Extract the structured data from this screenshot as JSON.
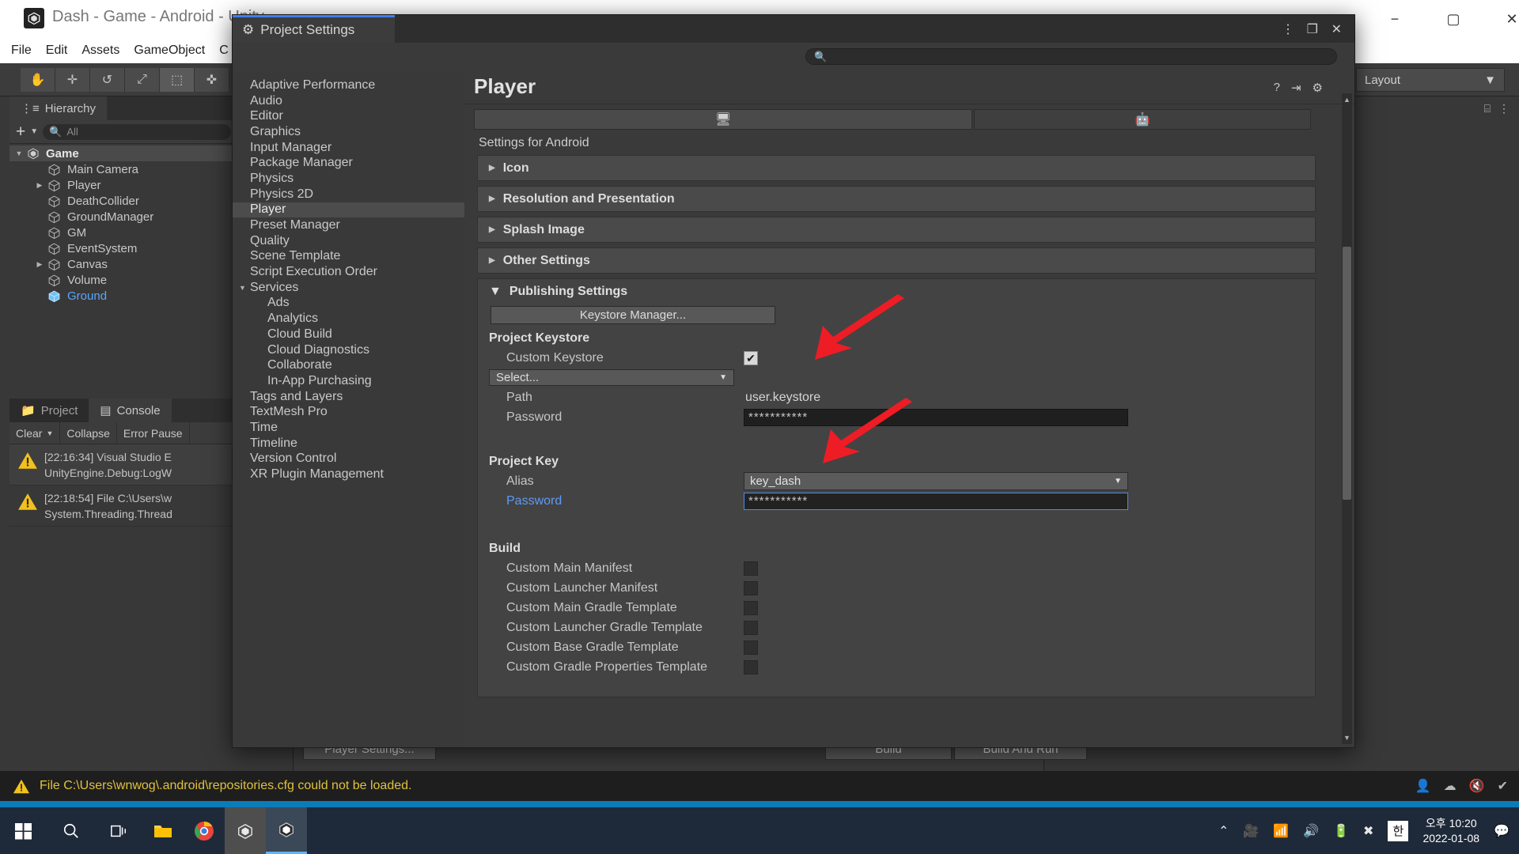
{
  "unity_window": {
    "title": "Dash - Game - Android - Unity",
    "app_icon": "unity-icon",
    "menus": [
      "File",
      "Edit",
      "Assets",
      "GameObject",
      "C"
    ],
    "window_controls": {
      "minimize": "−",
      "maximize": "▢",
      "close": "✕"
    },
    "toolbar": {
      "tools": [
        "hand-tool",
        "move-tool",
        "rotate-tool",
        "scale-tool",
        "rect-tool",
        "transform-tool"
      ],
      "layout_label": "Layout",
      "layout_caret": "▼"
    }
  },
  "hierarchy": {
    "tab_label": "Hierarchy",
    "add_label": "+",
    "add_caret": "▼",
    "search_placeholder": "All",
    "items": [
      {
        "label": "Game",
        "depth": 0,
        "twisty": "▼",
        "icon": "unity-scene-icon",
        "selected": true
      },
      {
        "label": "Main Camera",
        "depth": 1,
        "twisty": "",
        "icon": "cube-icon",
        "selected": false
      },
      {
        "label": "Player",
        "depth": 1,
        "twisty": "▶",
        "icon": "cube-icon",
        "selected": false
      },
      {
        "label": "DeathCollider",
        "depth": 1,
        "twisty": "",
        "icon": "cube-icon",
        "selected": false
      },
      {
        "label": "GroundManager",
        "depth": 1,
        "twisty": "",
        "icon": "cube-icon",
        "selected": false
      },
      {
        "label": "GM",
        "depth": 1,
        "twisty": "",
        "icon": "cube-icon",
        "selected": false
      },
      {
        "label": "EventSystem",
        "depth": 1,
        "twisty": "",
        "icon": "cube-icon",
        "selected": false
      },
      {
        "label": "Canvas",
        "depth": 1,
        "twisty": "▶",
        "icon": "cube-icon",
        "selected": false
      },
      {
        "label": "Volume",
        "depth": 1,
        "twisty": "",
        "icon": "cube-icon",
        "selected": false
      },
      {
        "label": "Ground",
        "depth": 1,
        "twisty": "",
        "icon": "cube-icon-blue",
        "selected": false,
        "highlight": true
      }
    ]
  },
  "console": {
    "tabs": [
      {
        "label": "Project",
        "icon": "folder-icon",
        "active": false
      },
      {
        "label": "Console",
        "icon": "console-icon",
        "active": true
      }
    ],
    "toolbar": {
      "clear": "Clear",
      "clear_caret": "▼",
      "collapse": "Collapse",
      "error_pause": "Error Pause"
    },
    "logs": [
      {
        "icon": "warning-icon",
        "line1": "[22:16:34] Visual Studio E",
        "line2": "UnityEngine.Debug:LogW"
      },
      {
        "icon": "warning-icon",
        "line1": "[22:18:54]  File C:\\Users\\w",
        "line2": "System.Threading.Thread"
      }
    ]
  },
  "build_settings": {
    "player_settings_button": "Player Settings...",
    "build_button": "Build",
    "build_and_run_button": "Build And Run"
  },
  "project_settings": {
    "window_title": "Project Settings",
    "window_icon": "gear-icon",
    "kebab": "⋮",
    "restore": "❐",
    "close": "✕",
    "search_placeholder": "",
    "search_icon": "search-icon",
    "categories": [
      {
        "label": "Adaptive Performance",
        "child": false,
        "twisty": "",
        "selected": false
      },
      {
        "label": "Audio",
        "child": false,
        "twisty": "",
        "selected": false
      },
      {
        "label": "Editor",
        "child": false,
        "twisty": "",
        "selected": false
      },
      {
        "label": "Graphics",
        "child": false,
        "twisty": "",
        "selected": false
      },
      {
        "label": "Input Manager",
        "child": false,
        "twisty": "",
        "selected": false
      },
      {
        "label": "Package Manager",
        "child": false,
        "twisty": "",
        "selected": false
      },
      {
        "label": "Physics",
        "child": false,
        "twisty": "",
        "selected": false
      },
      {
        "label": "Physics 2D",
        "child": false,
        "twisty": "",
        "selected": false
      },
      {
        "label": "Player",
        "child": false,
        "twisty": "",
        "selected": true
      },
      {
        "label": "Preset Manager",
        "child": false,
        "twisty": "",
        "selected": false
      },
      {
        "label": "Quality",
        "child": false,
        "twisty": "",
        "selected": false
      },
      {
        "label": "Scene Template",
        "child": false,
        "twisty": "",
        "selected": false
      },
      {
        "label": "Script Execution Order",
        "child": false,
        "twisty": "",
        "selected": false
      },
      {
        "label": "Services",
        "child": false,
        "twisty": "▼",
        "selected": false
      },
      {
        "label": "Ads",
        "child": true,
        "twisty": "",
        "selected": false
      },
      {
        "label": "Analytics",
        "child": true,
        "twisty": "",
        "selected": false
      },
      {
        "label": "Cloud Build",
        "child": true,
        "twisty": "",
        "selected": false
      },
      {
        "label": "Cloud Diagnostics",
        "child": true,
        "twisty": "",
        "selected": false
      },
      {
        "label": "Collaborate",
        "child": true,
        "twisty": "",
        "selected": false
      },
      {
        "label": "In-App Purchasing",
        "child": true,
        "twisty": "",
        "selected": false
      },
      {
        "label": "Tags and Layers",
        "child": false,
        "twisty": "",
        "selected": false
      },
      {
        "label": "TextMesh Pro",
        "child": false,
        "twisty": "",
        "selected": false
      },
      {
        "label": "Time",
        "child": false,
        "twisty": "",
        "selected": false
      },
      {
        "label": "Timeline",
        "child": false,
        "twisty": "",
        "selected": false
      },
      {
        "label": "Version Control",
        "child": false,
        "twisty": "",
        "selected": false
      },
      {
        "label": "XR Plugin Management",
        "child": false,
        "twisty": "",
        "selected": false
      }
    ],
    "page_title": "Player",
    "head_icons": [
      "help-icon",
      "preset-icon",
      "gear-icon"
    ],
    "platform_tabs": [
      {
        "icon": "monitor-icon",
        "name": "desktop",
        "active": true
      },
      {
        "icon": "android-icon",
        "name": "android",
        "active": false
      }
    ],
    "settings_for": "Settings for Android",
    "collapsed_sections": [
      {
        "label": "Icon",
        "twisty": "▶"
      },
      {
        "label": "Resolution and Presentation",
        "twisty": "▶"
      },
      {
        "label": "Splash Image",
        "twisty": "▶"
      },
      {
        "label": "Other Settings",
        "twisty": "▶"
      }
    ],
    "publishing": {
      "header": "Publishing Settings",
      "header_twisty": "▼",
      "keystore_manager_button": "Keystore Manager...",
      "project_keystore": {
        "group_label": "Project Keystore",
        "custom_keystore_label": "Custom Keystore",
        "custom_keystore_checked": true,
        "checkmark": "✔",
        "select_label": "Select...",
        "select_caret": "▼",
        "path_label": "Path",
        "path_value": "user.keystore",
        "password_label": "Password",
        "password_value": "***********"
      },
      "project_key": {
        "group_label": "Project Key",
        "alias_label": "Alias",
        "alias_value": "key_dash",
        "alias_caret": "▼",
        "password_label": "Password",
        "password_value": "***********",
        "password_focused": true
      },
      "build": {
        "group_label": "Build",
        "rows": [
          {
            "label": "Custom Main Manifest",
            "checked": false
          },
          {
            "label": "Custom Launcher Manifest",
            "checked": false
          },
          {
            "label": "Custom Main Gradle Template",
            "checked": false
          },
          {
            "label": "Custom Launcher Gradle Template",
            "checked": false
          },
          {
            "label": "Custom Base Gradle Template",
            "checked": false
          },
          {
            "label": "Custom Gradle Properties Template",
            "checked": false
          }
        ]
      }
    },
    "scroll_up": "▲",
    "scroll_down": "▼"
  },
  "annotations": {
    "arrow_color": "#ee1c25",
    "arrows": [
      {
        "name": "arrow-pointing-to-keystore-path"
      },
      {
        "name": "arrow-pointing-to-key-alias"
      }
    ]
  },
  "status_bar": {
    "icon": "warning-icon",
    "message": "File C:\\Users\\wnwog\\.android\\repositories.cfg could not be loaded.",
    "right_icons": [
      "collab-icon",
      "cloud-icon",
      "mute-icon",
      "check-icon"
    ]
  },
  "taskbar": {
    "start_icon": "windows-icon",
    "items": [
      {
        "name": "search-icon"
      },
      {
        "name": "task-view-icon"
      },
      {
        "name": "file-explorer-icon"
      },
      {
        "name": "chrome-icon"
      },
      {
        "name": "unity-hub-icon"
      },
      {
        "name": "unity-editor-icon",
        "active": true
      }
    ],
    "tray": {
      "chevron": "⌃",
      "icons": [
        "camera-icon",
        "wifi-icon",
        "volume-icon",
        "battery-icon",
        "action-x-icon"
      ],
      "ime": "한",
      "time": "오후 10:20",
      "date": "2022-01-08",
      "notification": "notification-icon"
    }
  }
}
